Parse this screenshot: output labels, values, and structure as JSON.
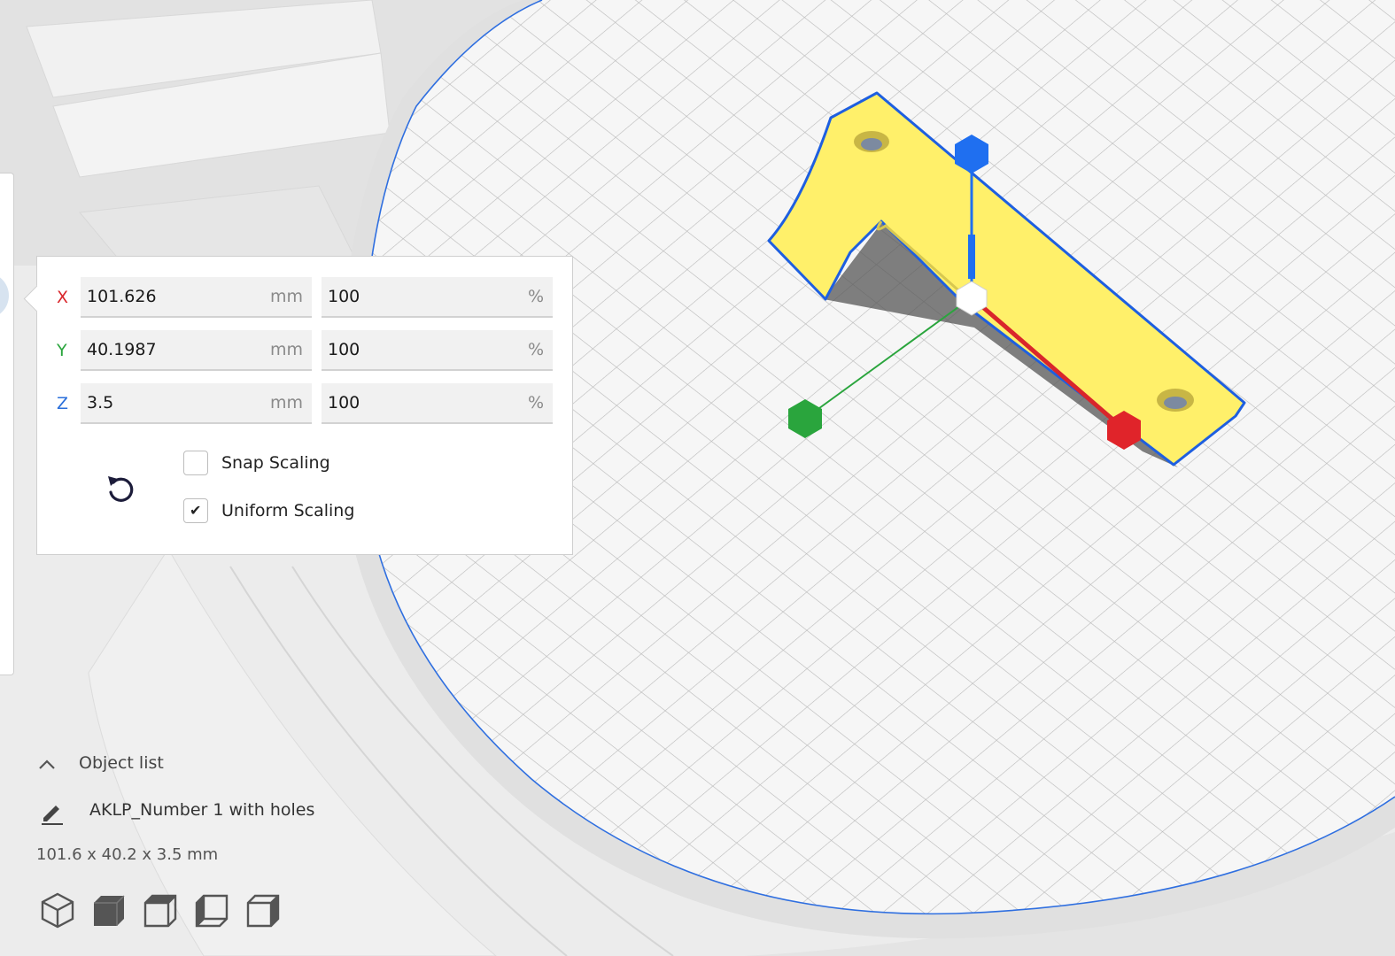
{
  "scale_tool": {
    "rows": [
      {
        "axis": "X",
        "axis_color": "#d9262b",
        "size": "101.626",
        "size_unit": "mm",
        "percent": "100",
        "percent_unit": "%"
      },
      {
        "axis": "Y",
        "axis_color": "#2aa53d",
        "size": "40.1987",
        "size_unit": "mm",
        "percent": "100",
        "percent_unit": "%"
      },
      {
        "axis": "Z",
        "axis_color": "#2a6fdb",
        "size": "3.5",
        "size_unit": "mm",
        "percent": "100",
        "percent_unit": "%"
      }
    ],
    "reset_icon": "reset-rotate-icon",
    "snap_scaling": {
      "label": "Snap Scaling",
      "checked": false
    },
    "uniform_scaling": {
      "label": "Uniform Scaling",
      "checked": true
    }
  },
  "object_list": {
    "title": "Object list",
    "expand_icon": "chevron-up-icon",
    "object_name": "AKLP_Number 1 with holes",
    "edit_icon": "pencil-icon",
    "dimensions": "101.6 x 40.2 x 3.5 mm",
    "view_buttons": [
      "3d-view-icon",
      "front-view-icon",
      "top-view-icon",
      "left-view-icon",
      "right-view-icon"
    ]
  },
  "scene": {
    "model_color": "#fff06a",
    "outline_color": "#1e5fe0",
    "handle_x_color": "#d9262b",
    "handle_y_color": "#2aa53d",
    "handle_z_color": "#1f6ff0"
  }
}
